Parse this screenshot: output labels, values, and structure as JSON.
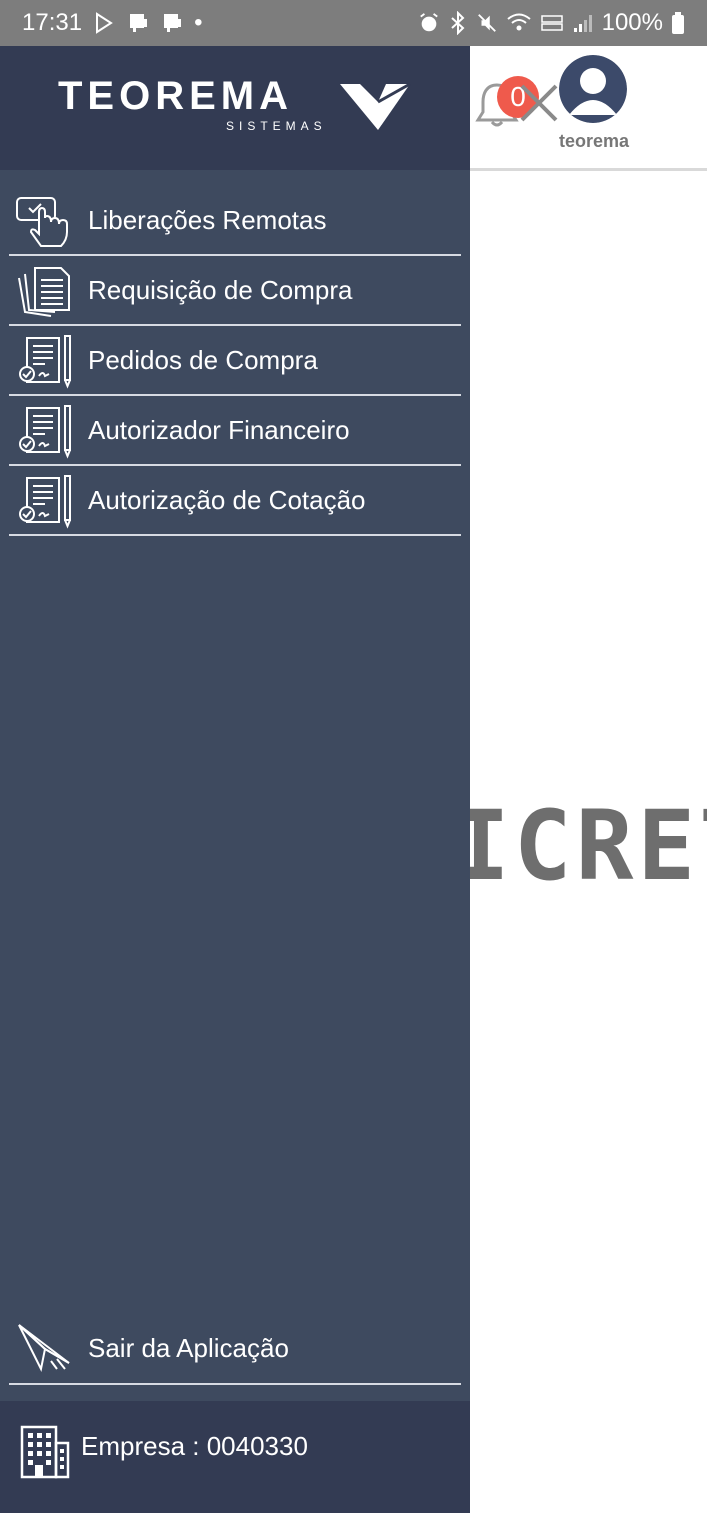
{
  "status_bar": {
    "time": "17:31",
    "battery": "100%",
    "dot": "•"
  },
  "header": {
    "notification_count": "0",
    "username": "teorema"
  },
  "logo": {
    "name": "TEOREMA",
    "subtitle": "SISTEMAS"
  },
  "menu": {
    "items": [
      {
        "label": "Liberações Remotas",
        "icon": "touch-icon"
      },
      {
        "label": "Requisição de Compra",
        "icon": "documents-icon"
      },
      {
        "label": "Pedidos de Compra",
        "icon": "contract-icon"
      },
      {
        "label": "Autorizador Financeiro",
        "icon": "contract-icon"
      },
      {
        "label": "Autorização de Cotação",
        "icon": "contract-icon"
      }
    ]
  },
  "logout": {
    "label": "Sair da Aplicação",
    "icon": "paper-plane-icon"
  },
  "footer": {
    "company": "Empresa : 0040330",
    "icon": "building-icon"
  },
  "background": {
    "partial_word": "ICRET"
  },
  "colors": {
    "drawer": "#3e4a5f",
    "drawer_header": "#333b53",
    "badge": "#ef5a4c",
    "status_bar": "#7d7d7d"
  }
}
